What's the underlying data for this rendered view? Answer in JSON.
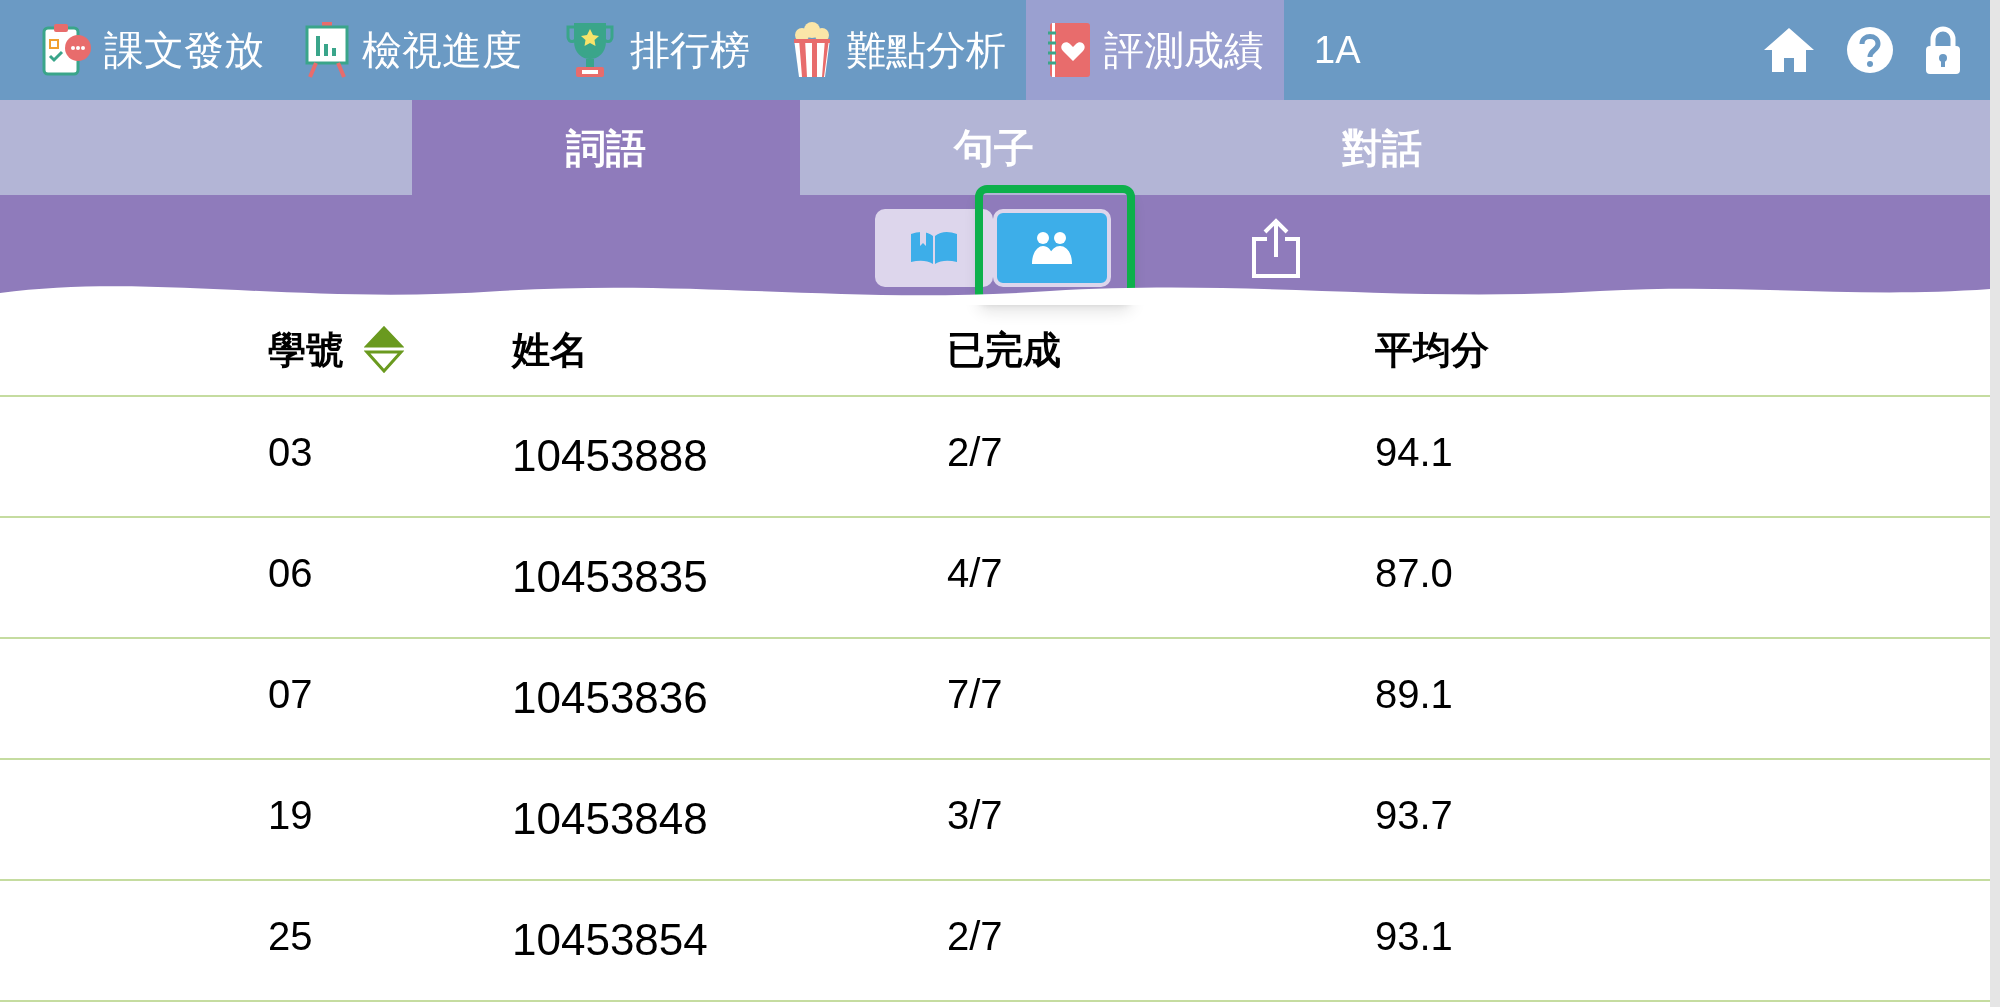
{
  "nav": {
    "items": [
      {
        "label": "課文發放",
        "kind": "clipboard",
        "selected": false
      },
      {
        "label": "檢視進度",
        "kind": "easel",
        "selected": false
      },
      {
        "label": "排行榜",
        "kind": "trophy",
        "selected": false
      },
      {
        "label": "難點分析",
        "kind": "popcorn",
        "selected": false
      },
      {
        "label": "評測成績",
        "kind": "notebook",
        "selected": true
      }
    ],
    "class_label": "1A"
  },
  "tabs": [
    {
      "label": "詞語",
      "selected": true
    },
    {
      "label": "句子",
      "selected": false
    },
    {
      "label": "對話",
      "selected": false
    }
  ],
  "view_toggle": [
    {
      "kind": "book",
      "selected": false
    },
    {
      "kind": "people",
      "selected": true
    }
  ],
  "table": {
    "columns": [
      {
        "label": "學號",
        "sorted": true
      },
      {
        "label": "姓名",
        "sorted": false
      },
      {
        "label": "已完成",
        "sorted": false
      },
      {
        "label": "平均分",
        "sorted": false
      }
    ],
    "rows": [
      [
        "03",
        "10453888",
        "2/7",
        "94.1"
      ],
      [
        "06",
        "10453835",
        "4/7",
        "87.0"
      ],
      [
        "07",
        "10453836",
        "7/7",
        "89.1"
      ],
      [
        "19",
        "10453848",
        "3/7",
        "93.7"
      ],
      [
        "25",
        "10453854",
        "2/7",
        "93.1"
      ]
    ]
  }
}
